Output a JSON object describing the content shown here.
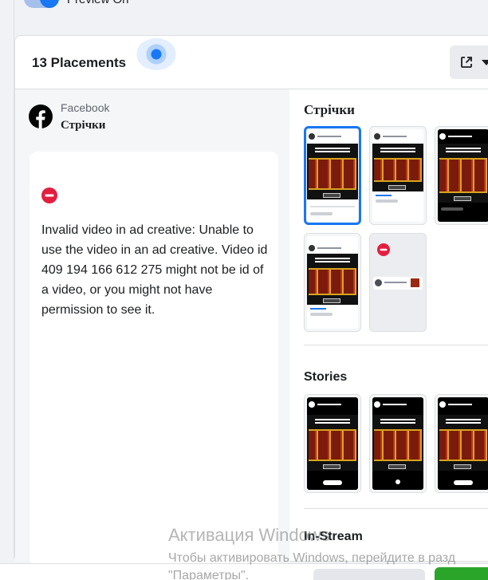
{
  "preview": {
    "label": "Preview On",
    "enabled": true
  },
  "panel": {
    "title": "13 Placements"
  },
  "placement": {
    "platform": "Facebook",
    "position": "Стрічки"
  },
  "error": {
    "message": "Invalid video in ad creative: Unable to use the video in an ad creative. Video id 409 194 166 612 275 might not be id of a video, or you might not have permission to see it."
  },
  "sections": [
    {
      "title": "Стрічки"
    },
    {
      "title": "Stories"
    },
    {
      "title": "In-Stream"
    }
  ],
  "watermark": {
    "title": "Активация Windows",
    "line1": "Чтобы активировать Windows, перейдите в разд",
    "line2": "\"Параметры\"."
  },
  "colors": {
    "accent": "#1877f2",
    "error": "#e41e3f",
    "publish": "#2aa52a"
  }
}
